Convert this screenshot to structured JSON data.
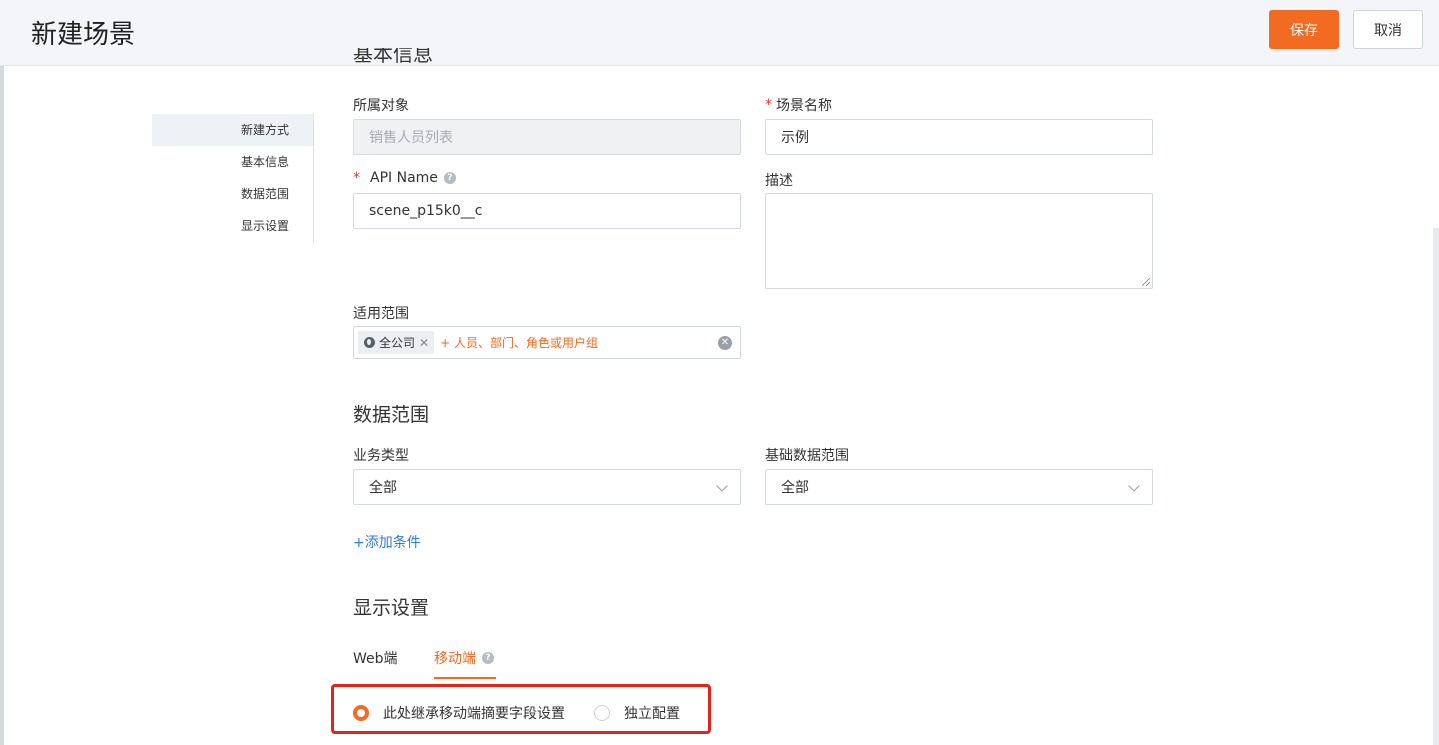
{
  "header": {
    "title": "新建场景",
    "save_label": "保存",
    "cancel_label": "取消"
  },
  "nav": {
    "items": [
      {
        "label": "新建方式",
        "active": true
      },
      {
        "label": "基本信息",
        "active": false
      },
      {
        "label": "数据范围",
        "active": false
      },
      {
        "label": "显示设置",
        "active": false
      }
    ]
  },
  "basic": {
    "section_title_partial": "基本信息",
    "object_label": "所属对象",
    "object_value": "销售人员列表",
    "scene_name_label": "场景名称",
    "scene_name_value": "示例",
    "api_name_label": "API Name",
    "api_name_value": "scene_p15k0__c",
    "desc_label": "描述",
    "desc_value": "",
    "scope_label": "适用范围",
    "scope_tag": "全公司",
    "scope_add": "+ 人员、部门、角色或用户组"
  },
  "data_range": {
    "title": "数据范围",
    "biz_type_label": "业务类型",
    "biz_type_value": "全部",
    "base_range_label": "基础数据范围",
    "base_range_value": "全部",
    "add_condition": "+添加条件"
  },
  "display": {
    "title": "显示设置",
    "tabs": [
      {
        "label": "Web端",
        "active": false
      },
      {
        "label": "移动端",
        "active": true
      }
    ],
    "options": [
      {
        "label": "此处继承移动端摘要字段设置",
        "checked": true
      },
      {
        "label": "独立配置",
        "checked": false
      }
    ]
  },
  "colors": {
    "accent": "#f36a21",
    "link": "#2f7ddb",
    "required": "#e5372f",
    "highlight": "#e1251b"
  }
}
